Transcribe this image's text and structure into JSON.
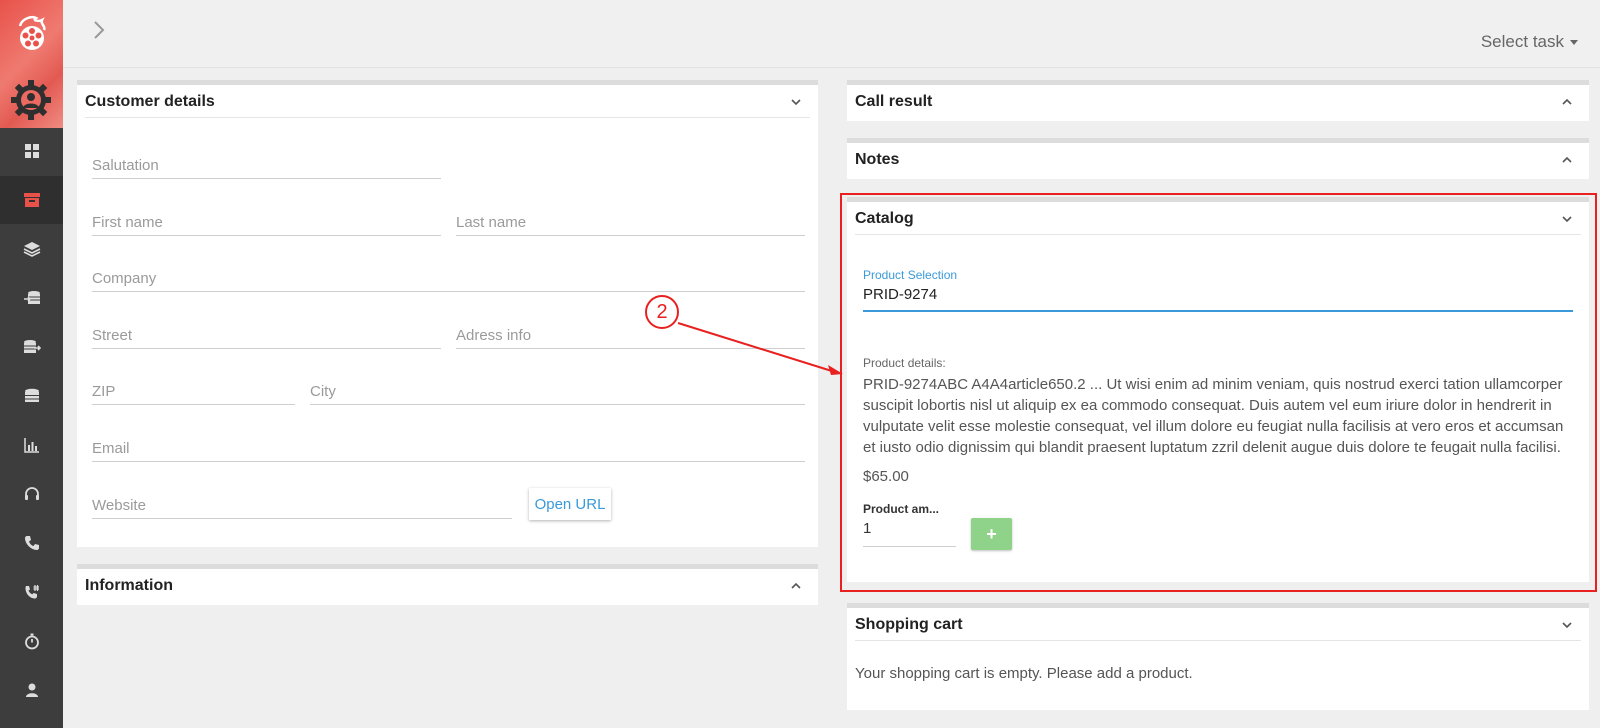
{
  "header": {
    "select_task": "Select task"
  },
  "sidebar": {
    "items": [
      {
        "icon": "dashboard-icon"
      },
      {
        "icon": "archive-icon",
        "active": true
      },
      {
        "icon": "layers-icon"
      },
      {
        "icon": "database-import-icon"
      },
      {
        "icon": "database-export-icon"
      },
      {
        "icon": "database-icon"
      },
      {
        "icon": "bar-chart-icon"
      },
      {
        "icon": "headset-icon"
      },
      {
        "icon": "phone-icon"
      },
      {
        "icon": "phone-dialpad-icon"
      },
      {
        "icon": "stopwatch-icon"
      },
      {
        "icon": "user-icon"
      }
    ]
  },
  "customer": {
    "title": "Customer details",
    "salutation": "Salutation",
    "first_name": "First name",
    "last_name": "Last name",
    "company": "Company",
    "street": "Street",
    "address_info": "Adress info",
    "zip": "ZIP",
    "city": "City",
    "email": "Email",
    "website": "Website",
    "open_url": "Open URL"
  },
  "information": {
    "title": "Information"
  },
  "call_result": {
    "title": "Call result"
  },
  "notes": {
    "title": "Notes"
  },
  "catalog": {
    "title": "Catalog",
    "product_selection_label": "Product Selection",
    "product_selection_value": "PRID-9274",
    "details_label": "Product details:",
    "details_text": "PRID-9274ABC A4A4article650.2 ... Ut wisi enim ad minim veniam, quis nostrud exerci tation ullamcorper suscipit lobortis nisl ut aliquip ex ea commodo consequat. Duis autem vel eum iriure dolor in hendrerit in vulputate velit esse molestie consequat, vel illum dolore eu feugiat nulla facilisis at vero eros et accumsan et iusto odio dignissim qui blandit praesent luptatum zzril delenit augue duis dolore te feugait nulla facilisi.",
    "price": "$65.00",
    "amount_label": "Product am...",
    "amount_value": "1",
    "add_label": "+"
  },
  "cart": {
    "title": "Shopping cart",
    "empty_text": "Your shopping cart is empty. Please add a product."
  },
  "annotation": {
    "number": "2"
  },
  "colors": {
    "accent": "#3a9ad9",
    "highlight": "#e82020",
    "add_button": "#8fd38a",
    "brand": "#e8524a"
  }
}
